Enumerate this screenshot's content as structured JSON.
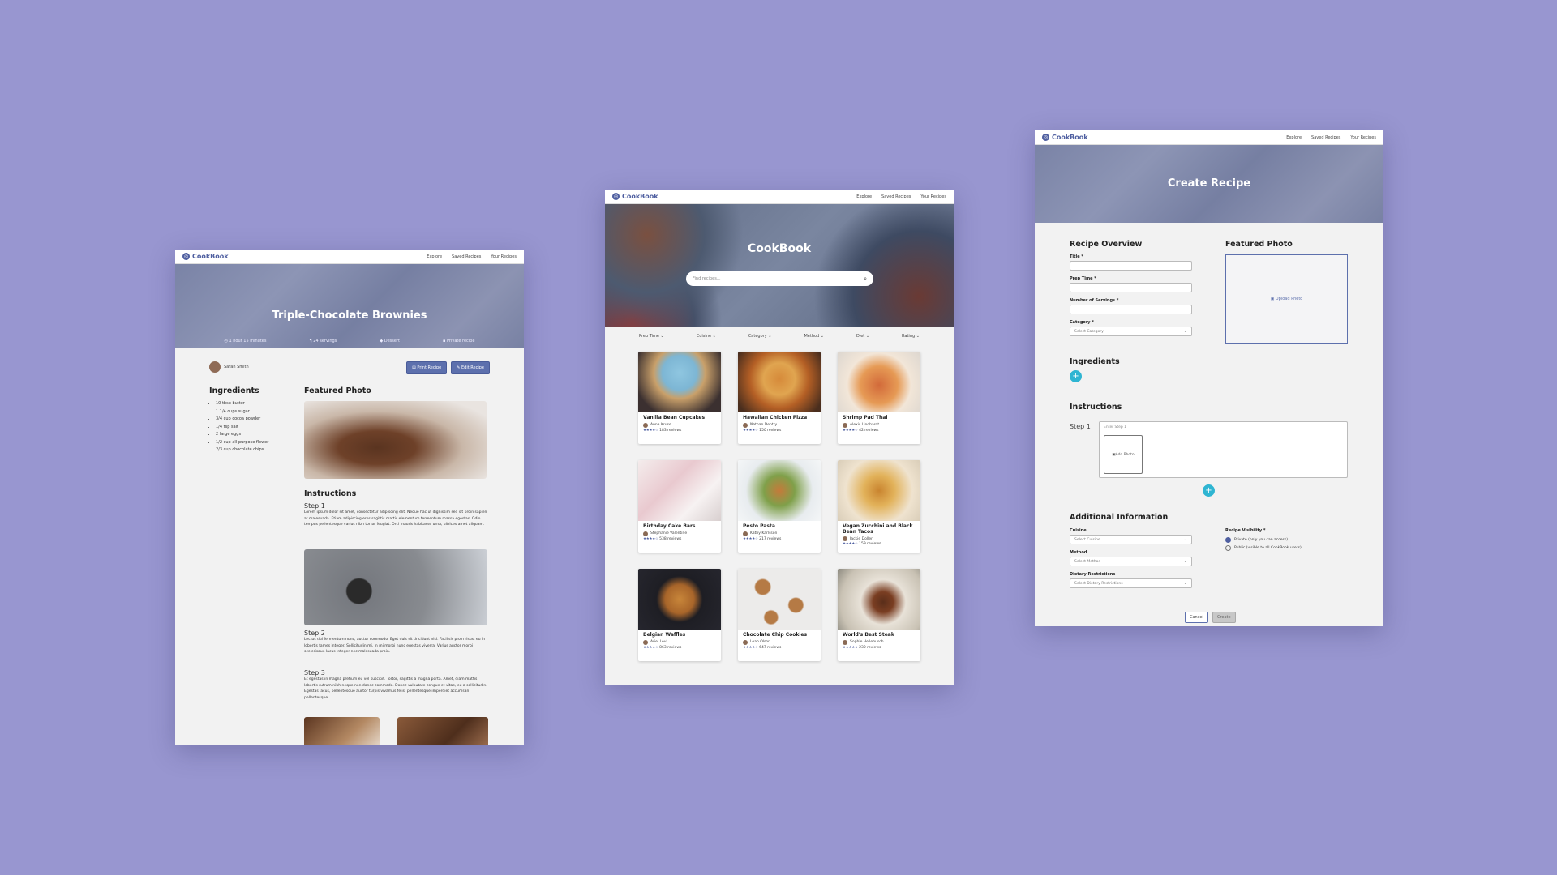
{
  "brand": {
    "name": "CookBook",
    "accent": "#4f5fa0",
    "cyan": "#2fb5d2",
    "background": "#9896d0"
  },
  "nav": {
    "links": [
      "Explore",
      "Saved Recipes",
      "Your Recipes"
    ]
  },
  "detail": {
    "title": "Triple-Chocolate Brownies",
    "meta": {
      "time": "1 hour 15 minutes",
      "servings": "24 servings",
      "category": "Dessert",
      "visibility": "Private recipe"
    },
    "author": "Sarah Smith",
    "buttons": {
      "print": "Print Recipe",
      "edit": "Edit Recipe"
    },
    "ingredients_heading": "Ingredients",
    "ingredients": [
      "10 tbsp butter",
      "1 1/4 cups sugar",
      "3/4 cup cocoa powder",
      "1/4 tsp salt",
      "2 large eggs",
      "1/2 cup all-purpose flower",
      "2/3 cup chocolate chips"
    ],
    "featured_heading": "Featured Photo",
    "instructions_heading": "Instructions",
    "steps": [
      {
        "label": "Step 1",
        "text": "Lorem ipsum dolor sit amet, consectetur adipiscing elit. Neque hac ut dignissim sed sit proin sapien at malesuada. Etiam adipiscing eros sagittis mattis elementum fermentum massa egestas. Odio tempus pellentesque varius nibh tortor feugiat. Orci mauris habitasse urna, ultrices amet aliquam."
      },
      {
        "label": "Step 2",
        "text": "Lectus dui fermentum nunc, auctor commodo. Eget duis sit tincidunt nisl. Facilisis proin risus, eu in lobortis fames integer. Sollicitudin mi, in mi morbi nunc egestas viverra. Varius auctor morbi scelerisque lacus integer nec malesuada proin."
      },
      {
        "label": "Step 3",
        "text": "Et egestas in magna pretium eu vel suscipit. Tortor, sagittis a magna porta. Amet, diam mattis lobortis rutrum nibh neque non donec commodo. Donec vulputate congue et vitae, eu a sollicitudin. Egestas lacus, pellentesque auctor turpis vivamus felis, pellentesque imperdiet accumsan pellentesque."
      }
    ]
  },
  "explore": {
    "title": "CookBook",
    "search_placeholder": "Find recipes...",
    "filters": [
      "Prep Time",
      "Cuisine",
      "Category",
      "Method",
      "Diet",
      "Rating"
    ],
    "cards": [
      {
        "title": "Vanilla Bean Cupcakes",
        "author": "Anna Kruse",
        "stars": "★★★★☆",
        "reviews": "183 reviews"
      },
      {
        "title": "Hawaiian Chicken Pizza",
        "author": "Nathan Dentry",
        "stars": "★★★★☆",
        "reviews": "150 reviews"
      },
      {
        "title": "Shrimp Pad Thai",
        "author": "Alexis Lindhardt",
        "stars": "★★★★☆",
        "reviews": "42 reviews"
      },
      {
        "title": "Birthday Cake Bars",
        "author": "Stephanie Valentine",
        "stars": "★★★★☆",
        "reviews": "538 reviews"
      },
      {
        "title": "Pesto Pasta",
        "author": "Kathy Karlsson",
        "stars": "★★★★☆",
        "reviews": "217 reviews"
      },
      {
        "title": "Vegan Zucchini and Black Bean Tacos",
        "author": "Jackie Doller",
        "stars": "★★★★☆",
        "reviews": "159 reviews"
      },
      {
        "title": "Belgian Waffles",
        "author": "Ariel Levi",
        "stars": "★★★★☆",
        "reviews": "863 reviews"
      },
      {
        "title": "Chocolate Chip Cookies",
        "author": "Leah Olson",
        "stars": "★★★★☆",
        "reviews": "647 reviews"
      },
      {
        "title": "World's Best Steak",
        "author": "Sophie Hellebusch",
        "stars": "★★★★★",
        "reviews": "230 reviews"
      }
    ]
  },
  "create": {
    "title": "Create Recipe",
    "overview_heading": "Recipe Overview",
    "fields": {
      "title": "Title *",
      "prep": "Prep Time *",
      "servings": "Number of Servings *",
      "category": "Category *"
    },
    "category_placeholder": "Select Category",
    "featured_heading": "Featured Photo",
    "upload": "Upload Photo",
    "ingredients_heading": "Ingredients",
    "instructions_heading": "Instructions",
    "step_label": "Step 1",
    "step_placeholder": "Enter Step 1",
    "add_photo": "Add Photo",
    "additional_heading": "Additional Information",
    "cuisine": {
      "label": "Cuisine",
      "placeholder": "Select Cuisine"
    },
    "method": {
      "label": "Method",
      "placeholder": "Select Method"
    },
    "dietary": {
      "label": "Dietary Restrictions",
      "placeholder": "Select Dietary Restrictions"
    },
    "visibility": {
      "label": "Recipe Visibility *",
      "private": "Private (only you can access)",
      "public": "Public (visible to all CookBook users)"
    },
    "cancel": "Cancel",
    "create": "Create"
  }
}
